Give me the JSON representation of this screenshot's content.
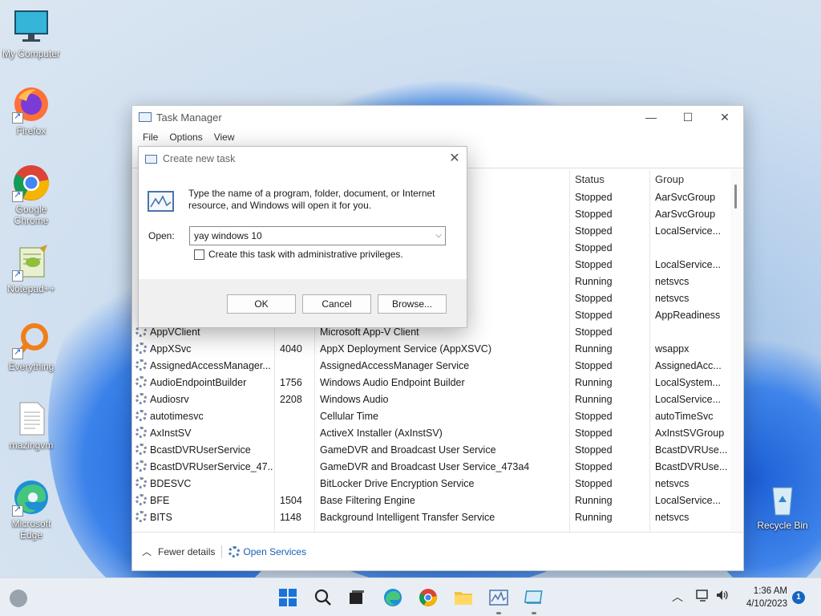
{
  "colors": {
    "accent": "#1a5fb4",
    "taskbar": "#e9eef5",
    "window": "#ffffff"
  },
  "desktop": {
    "icons": [
      {
        "label": "My Computer",
        "icon": "monitor-icon"
      },
      {
        "label": "Firefox",
        "icon": "firefox-icon"
      },
      {
        "label": "Google Chrome",
        "icon": "chrome-icon"
      },
      {
        "label": "Notepad++",
        "icon": "notepadpp-icon"
      },
      {
        "label": "Everything",
        "icon": "everything-search-icon"
      },
      {
        "label": "mazingvm",
        "icon": "document-icon"
      },
      {
        "label": "Microsoft Edge",
        "icon": "edge-icon"
      },
      {
        "label": "Recycle Bin",
        "icon": "recycle-bin-icon"
      }
    ]
  },
  "task_manager": {
    "title": "Task Manager",
    "menu": [
      "File",
      "Options",
      "View"
    ],
    "controls": {
      "minimize": "—",
      "maximize": "☐",
      "close": "✕"
    },
    "columns": {
      "status": "Status",
      "group": "Group"
    },
    "rows": [
      {
        "name": "",
        "pid": "",
        "desc": "",
        "status": "Stopped",
        "group": "AarSvcGroup"
      },
      {
        "name": "",
        "pid": "",
        "desc": "",
        "status": "Stopped",
        "group": "AarSvcGroup"
      },
      {
        "name": "",
        "pid": "",
        "desc": "",
        "status": "Stopped",
        "group": "LocalService..."
      },
      {
        "name": "",
        "pid": "",
        "desc": "",
        "status": "Stopped",
        "group": ""
      },
      {
        "name": "",
        "pid": "",
        "desc": "",
        "status": "Stopped",
        "group": "LocalService..."
      },
      {
        "name": "",
        "pid": "",
        "desc": "",
        "status": "Running",
        "group": "netsvcs"
      },
      {
        "name": "",
        "pid": "",
        "desc": "",
        "status": "Stopped",
        "group": "netsvcs"
      },
      {
        "name": "",
        "pid": "",
        "desc": "",
        "status": "Stopped",
        "group": "AppReadiness"
      },
      {
        "name": "AppVClient",
        "pid": "",
        "desc": "Microsoft App-V Client",
        "status": "Stopped",
        "group": ""
      },
      {
        "name": "AppXSvc",
        "pid": "4040",
        "desc": "AppX Deployment Service (AppXSVC)",
        "status": "Running",
        "group": "wsappx"
      },
      {
        "name": "AssignedAccessManager...",
        "pid": "",
        "desc": "AssignedAccessManager Service",
        "status": "Stopped",
        "group": "AssignedAcc..."
      },
      {
        "name": "AudioEndpointBuilder",
        "pid": "1756",
        "desc": "Windows Audio Endpoint Builder",
        "status": "Running",
        "group": "LocalSystem..."
      },
      {
        "name": "Audiosrv",
        "pid": "2208",
        "desc": "Windows Audio",
        "status": "Running",
        "group": "LocalService..."
      },
      {
        "name": "autotimesvc",
        "pid": "",
        "desc": "Cellular Time",
        "status": "Stopped",
        "group": "autoTimeSvc"
      },
      {
        "name": "AxInstSV",
        "pid": "",
        "desc": "ActiveX Installer (AxInstSV)",
        "status": "Stopped",
        "group": "AxInstSVGroup"
      },
      {
        "name": "BcastDVRUserService",
        "pid": "",
        "desc": "GameDVR and Broadcast User Service",
        "status": "Stopped",
        "group": "BcastDVRUse..."
      },
      {
        "name": "BcastDVRUserService_47...",
        "pid": "",
        "desc": "GameDVR and Broadcast User Service_473a4",
        "status": "Stopped",
        "group": "BcastDVRUse..."
      },
      {
        "name": "BDESVC",
        "pid": "",
        "desc": "BitLocker Drive Encryption Service",
        "status": "Stopped",
        "group": "netsvcs"
      },
      {
        "name": "BFE",
        "pid": "1504",
        "desc": "Base Filtering Engine",
        "status": "Running",
        "group": "LocalService..."
      },
      {
        "name": "BITS",
        "pid": "1148",
        "desc": "Background Intelligent Transfer Service",
        "status": "Running",
        "group": "netsvcs"
      }
    ],
    "footer": {
      "fewer_details": "Fewer details",
      "open_services": "Open Services"
    }
  },
  "run_dialog": {
    "title": "Create new task",
    "message": "Type the name of a program, folder, document, or Internet resource, and Windows will open it for you.",
    "open_label": "Open:",
    "open_value": "yay windows 10",
    "admin_checkbox": "Create this task with administrative privileges.",
    "admin_checked": false,
    "ok": "OK",
    "cancel": "Cancel",
    "browse": "Browse..."
  },
  "taskbar": {
    "apps": [
      "windows-start-icon",
      "search-icon",
      "task-view-icon",
      "edge-icon",
      "chrome-icon",
      "file-explorer-icon",
      "task-manager-icon",
      "run-dialog-icon"
    ],
    "time": "1:36 AM",
    "date": "4/10/2023",
    "notifications": "1"
  }
}
